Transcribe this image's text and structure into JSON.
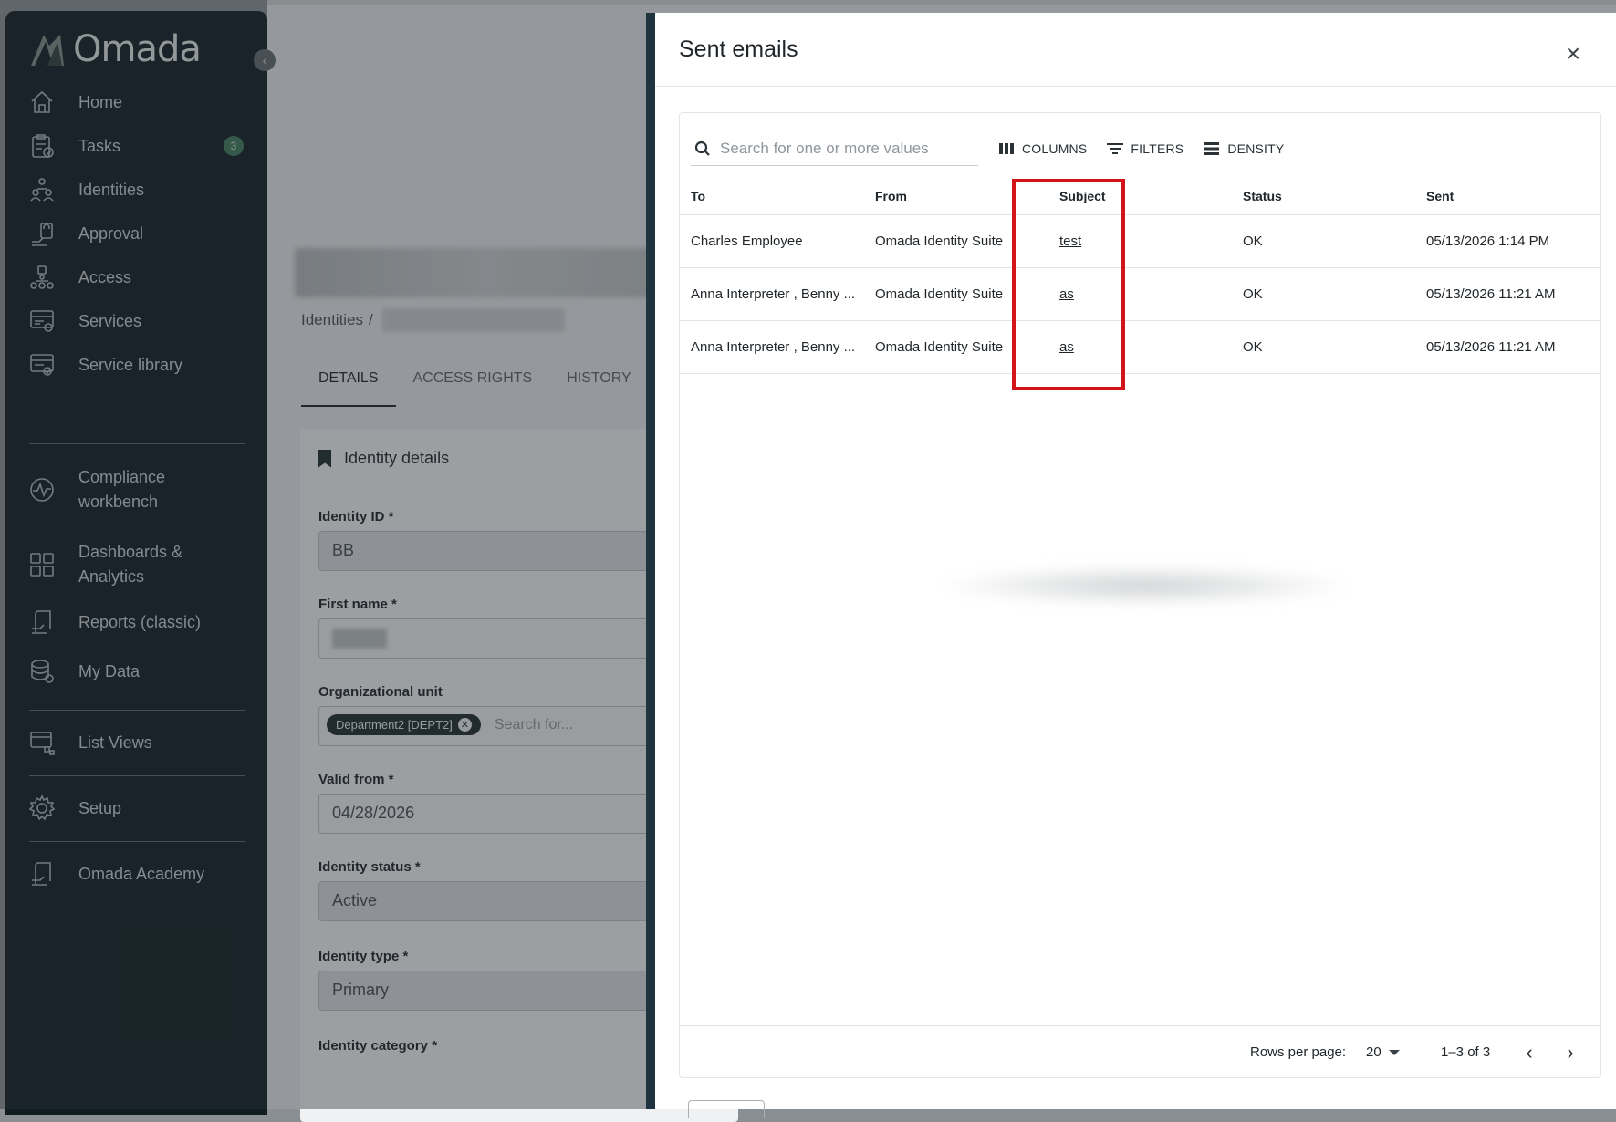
{
  "app": {
    "logo_text": "Omada"
  },
  "sidebar": {
    "items": [
      {
        "label": "Home",
        "icon": "home-icon"
      },
      {
        "label": "Tasks",
        "icon": "tasks-icon",
        "badge": "3"
      },
      {
        "label": "Identities",
        "icon": "identities-icon"
      },
      {
        "label": "Approval",
        "icon": "approval-icon"
      },
      {
        "label": "Access",
        "icon": "access-icon"
      },
      {
        "label": "Services",
        "icon": "services-icon"
      },
      {
        "label": "Service library",
        "icon": "service-library-icon"
      },
      {
        "label": "Compliance workbench",
        "icon": "compliance-icon"
      },
      {
        "label": "Dashboards & Analytics",
        "icon": "dashboard-icon"
      },
      {
        "label": "Reports (classic)",
        "icon": "reports-icon"
      },
      {
        "label": "My Data",
        "icon": "my-data-icon"
      },
      {
        "label": "List Views",
        "icon": "list-views-icon"
      },
      {
        "label": "Setup",
        "icon": "gear-icon"
      },
      {
        "label": "Omada Academy",
        "icon": "academy-icon"
      }
    ]
  },
  "background_page": {
    "breadcrumb_root": "Identities",
    "breadcrumb_sep": "/",
    "tabs": [
      "DETAILS",
      "ACCESS RIGHTS",
      "HISTORY"
    ],
    "card_title": "Identity details",
    "fields": {
      "identity_id": {
        "label": "Identity ID *",
        "value": "BB"
      },
      "first_name": {
        "label": "First name *"
      },
      "org_unit": {
        "label": "Organizational unit",
        "chip": "Department2 [DEPT2]",
        "placeholder": "Search for..."
      },
      "valid_from": {
        "label": "Valid from *",
        "value": "04/28/2026"
      },
      "identity_status": {
        "label": "Identity status *",
        "value": "Active"
      },
      "identity_type": {
        "label": "Identity type *",
        "value": "Primary"
      },
      "identity_category": {
        "label": "Identity category *"
      }
    }
  },
  "modal": {
    "title": "Sent emails",
    "search_placeholder": "Search for one or more values",
    "toolbar": {
      "columns": "COLUMNS",
      "filters": "FILTERS",
      "density": "DENSITY"
    },
    "columns": [
      "To",
      "From",
      "Subject",
      "Status",
      "Sent"
    ],
    "rows": [
      {
        "to": "Charles Employee",
        "from": "Omada Identity Suite",
        "subject": "test",
        "status": "OK",
        "sent": "05/13/2026 1:14 PM"
      },
      {
        "to": "Anna Interpreter , Benny ...",
        "from": "Omada Identity Suite",
        "subject": "as",
        "status": "OK",
        "sent": "05/13/2026 11:21 AM"
      },
      {
        "to": "Anna Interpreter , Benny ...",
        "from": "Omada Identity Suite",
        "subject": "as",
        "status": "OK",
        "sent": "05/13/2026 11:21 AM"
      }
    ],
    "footer": {
      "rows_per_page_label": "Rows per page:",
      "rows_per_page": "20",
      "page_info": "1–3 of 3"
    },
    "highlight_color": "#d4141b"
  }
}
